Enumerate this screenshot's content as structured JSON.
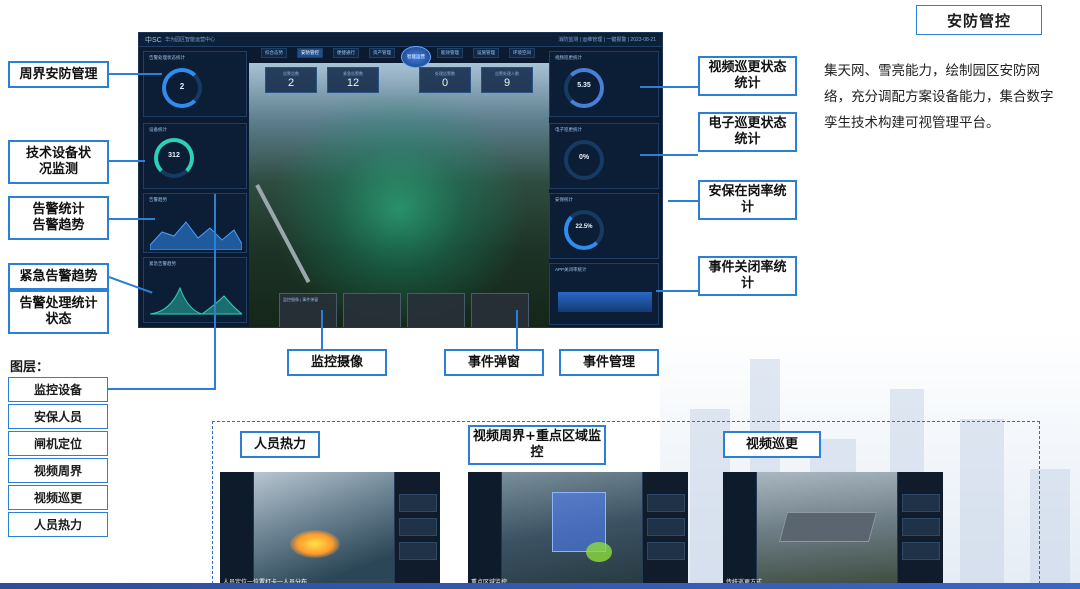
{
  "title": "安防管控",
  "description": "集天网、雪亮能力，绘制园区安防网络，充分调配方案设备能力，集合数字孪生技术构建可视管理平台。",
  "callouts": {
    "perimeter": "周界安防管理",
    "equipment": "技术设备状况监测",
    "alarm_stats": "告警统计\n告警趋势",
    "emergency_trend": "紧急告警趋势",
    "alarm_handling": "告警处理统计状态",
    "video_patrol_stats": "视频巡更状态统计",
    "e_patrol_stats": "电子巡更状态统计",
    "onduty_rate": "安保在岗率统计",
    "event_close_rate": "事件关闭率统计",
    "monitor_camera": "监控摄像",
    "event_popup": "事件弹窗",
    "event_mgmt": "事件管理"
  },
  "layers": {
    "title": "图层：",
    "items": [
      "监控设备",
      "安保人员",
      "闸机定位",
      "视频周界",
      "视频巡更",
      "人员热力"
    ]
  },
  "views": [
    {
      "label": "人员热力",
      "caption": "人员定位一位置打卡一人员分布"
    },
    {
      "label": "视频周界+重点区域监控",
      "caption": "重点区域监控"
    },
    {
      "label": "视频巡更",
      "caption": "传统巡更方式"
    }
  ],
  "dashboard": {
    "logo": "中SC",
    "app_title": "华为园区智能运营中心",
    "status": "消防监测 | 运维管理 | 一键报警 | 2023-08-21",
    "tabs": [
      "综合态势",
      "安防管控",
      "便捷通行",
      "资产管理",
      "能效管理",
      "设施管理",
      "环境空间"
    ],
    "center_button": "智能运营",
    "cards": [
      {
        "label": "告警总数",
        "value": "2"
      },
      {
        "label": "紧急告警数",
        "value": "12"
      },
      {
        "label": "处理告警数",
        "value": "0"
      },
      {
        "label": "告警处理人数",
        "value": "9"
      }
    ],
    "left_panels": [
      {
        "title": "告警处理状态统计",
        "value": "2"
      },
      {
        "title": "设备统计",
        "value": "312"
      },
      {
        "title": "告警趋势",
        "value": ""
      },
      {
        "title": "紧急告警趋势",
        "value": ""
      }
    ],
    "right_panels": [
      {
        "title": "视频巡更统计",
        "value": "5.35"
      },
      {
        "title": "电子巡更统计",
        "value": "0%"
      },
      {
        "title": "安保统计",
        "value": "22.5%"
      },
      {
        "title": "APP关闭率统计",
        "value": ""
      }
    ],
    "popup_title": "监控摄像 | 事件弹窗"
  }
}
